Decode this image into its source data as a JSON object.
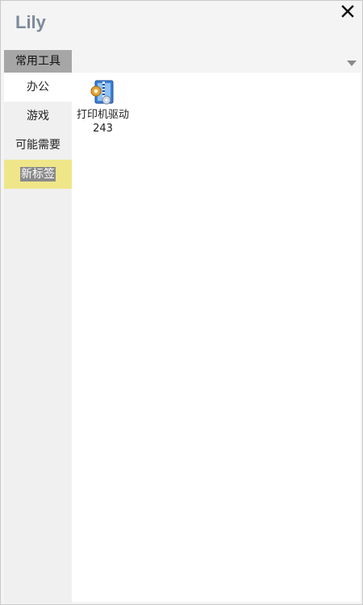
{
  "window": {
    "title": "Lily",
    "accent": "#7d8a9c"
  },
  "sidebar": {
    "header": "常用工具",
    "items": [
      {
        "label": "办公",
        "state": "active"
      },
      {
        "label": "游戏",
        "state": "normal"
      },
      {
        "label": "可能需要",
        "state": "normal"
      },
      {
        "label": "新标签",
        "state": "highlight",
        "highlight_color": "#efe68a"
      }
    ]
  },
  "content": {
    "tiles": [
      {
        "name": "打印机驱动",
        "count": "243",
        "icon": "printer-driver-icon"
      }
    ]
  }
}
